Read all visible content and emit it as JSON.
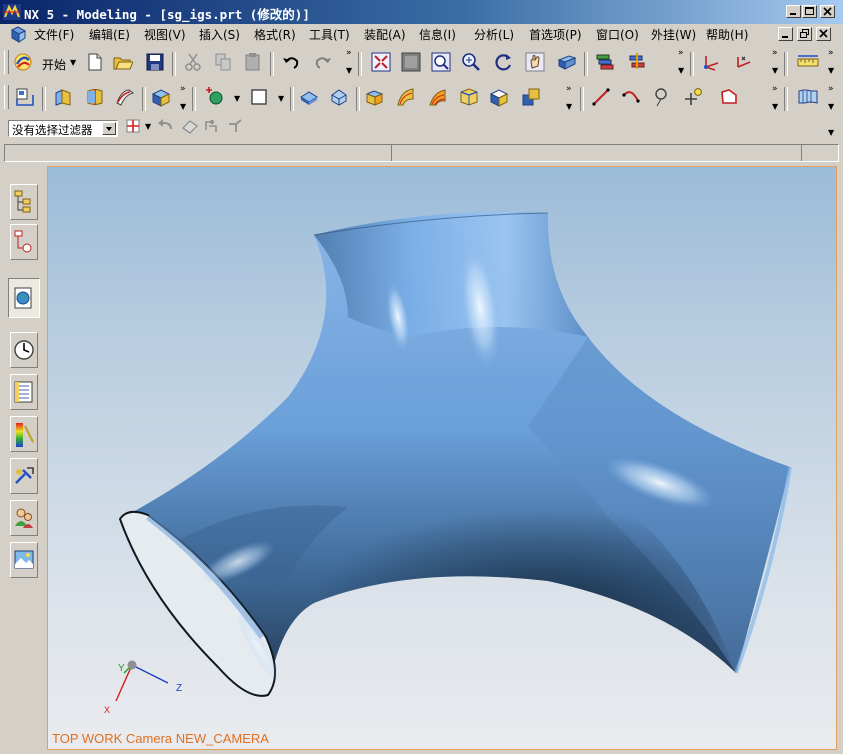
{
  "window": {
    "title": "NX 5 - Modeling - [sg_igs.prt (修改的)]",
    "caption_buttons": [
      "minimize-icon",
      "maximize-icon",
      "close-icon"
    ]
  },
  "menu": {
    "items": [
      {
        "label": "文件(F)"
      },
      {
        "label": "编辑(E)"
      },
      {
        "label": "视图(V)"
      },
      {
        "label": "插入(S)"
      },
      {
        "label": "格式(R)"
      },
      {
        "label": "工具(T)"
      },
      {
        "label": "装配(A)"
      },
      {
        "label": "信息(I)"
      },
      {
        "label": "分析(L)"
      },
      {
        "label": "首选项(P)"
      },
      {
        "label": "窗口(O)"
      },
      {
        "label": "外挂(W)"
      },
      {
        "label": "帮助(H)"
      }
    ]
  },
  "toolbar": {
    "start_label": "开始",
    "more_glyph": "»"
  },
  "selection": {
    "filter_value": "没有选择过滤器"
  },
  "graphics": {
    "view_label": "TOP WORK Camera NEW_CAMERA",
    "triad": {
      "x_label": "X",
      "y_label": "Y",
      "z_label": "Z"
    },
    "colors": {
      "part": "#6a9fd8",
      "highlight": "#e6f2ff",
      "shadow": "#243850",
      "label": "#e07020"
    }
  },
  "resource_bar": {
    "tabs": [
      {
        "icon": "assembly-navigator-icon"
      },
      {
        "icon": "part-navigator-icon"
      },
      {
        "icon": "web-browser-icon",
        "active": true
      },
      {
        "icon": "history-icon"
      },
      {
        "icon": "reuse-library-icon"
      },
      {
        "icon": "visualization-palette-icon"
      },
      {
        "icon": "process-studio-icon"
      },
      {
        "icon": "roles-icon"
      },
      {
        "icon": "system-scenes-icon"
      }
    ]
  },
  "colors": {
    "chrome": "#d4d0c8",
    "titlebar_start": "#0a246a",
    "titlebar_end": "#a6caf0",
    "viewport_border": "#e0a060"
  }
}
